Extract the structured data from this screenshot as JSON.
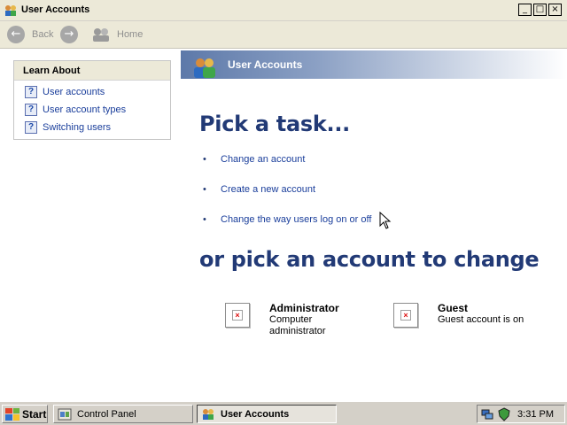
{
  "window": {
    "title": "User Accounts",
    "controls": {
      "minimize": "_",
      "maximize": "□",
      "close": "×"
    }
  },
  "nav": {
    "back_label": "Back",
    "forward_icon": "forward-arrow-icon",
    "home_label": "Home"
  },
  "learn_about": {
    "heading": "Learn About",
    "items": [
      {
        "label": "User accounts",
        "icon": "help-icon"
      },
      {
        "label": "User account types",
        "icon": "help-icon"
      },
      {
        "label": "Switching users",
        "icon": "help-icon"
      }
    ]
  },
  "banner": {
    "title": "User Accounts",
    "icon": "user-accounts-icon"
  },
  "tasks": {
    "heading": "Pick a task...",
    "items": [
      {
        "label": "Change an account"
      },
      {
        "label": "Create a new account"
      },
      {
        "label": "Change the way users log on or off"
      }
    ]
  },
  "accounts": {
    "heading": "or pick an account to change",
    "items": [
      {
        "name": "Administrator",
        "desc_line1": "Computer",
        "desc_line2": "administrator"
      },
      {
        "name": "Guest",
        "desc_line1": "Guest account is on",
        "desc_line2": ""
      }
    ]
  },
  "taskbar": {
    "start_label": "Start",
    "buttons": [
      {
        "label": "Control Panel",
        "active": false
      },
      {
        "label": "User Accounts",
        "active": true
      }
    ],
    "clock": "3:31 PM"
  },
  "colors": {
    "link": "#1a3e9b",
    "heading": "#223a76",
    "banner_start": "#5d79a9",
    "window_chrome": "#ece9d8",
    "taskbar": "#d4d0c8"
  }
}
